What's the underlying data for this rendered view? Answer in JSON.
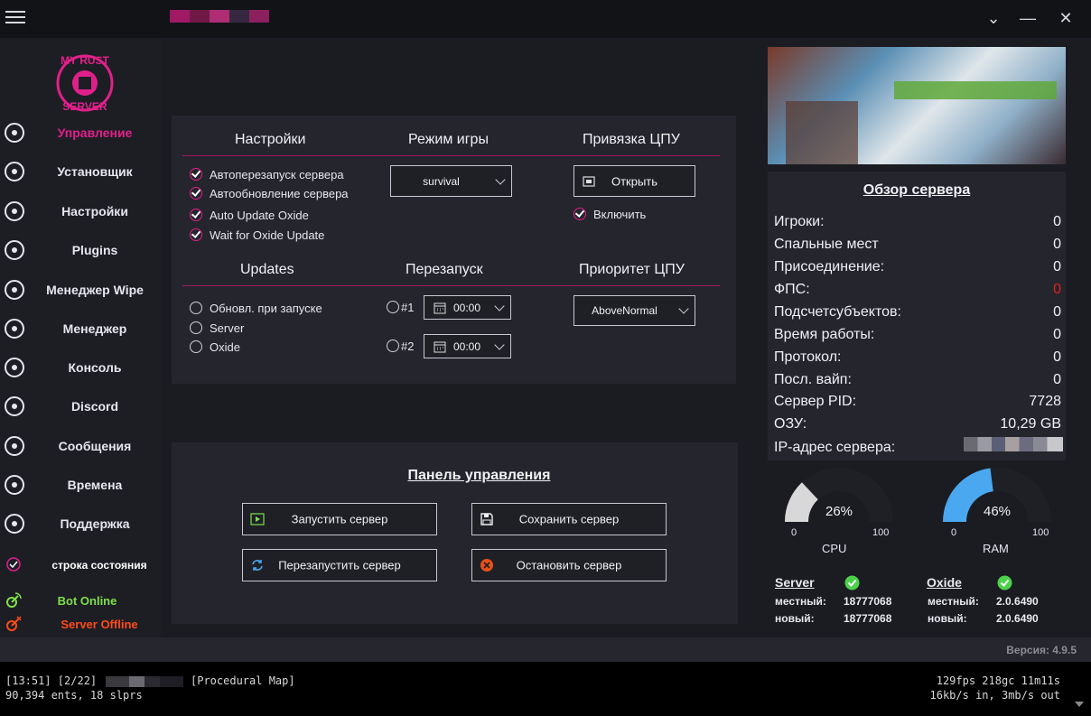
{
  "window": {
    "controls": {
      "collapse": "⌄",
      "minimize": "—",
      "close": "✕"
    }
  },
  "sidebar": {
    "logo_text": "MY RUST SERVER",
    "items": [
      {
        "label": "Управление",
        "icon": "dashboard-icon"
      },
      {
        "label": "Установщик",
        "icon": "gear-icon"
      },
      {
        "label": "Настройки",
        "icon": "sliders-icon"
      },
      {
        "label": "Plugins",
        "icon": "plug-icon"
      },
      {
        "label": "Менеджер Wipe",
        "icon": "layers-icon"
      },
      {
        "label": "Менеджер",
        "icon": "user-icon"
      },
      {
        "label": "Консоль",
        "icon": "terminal-icon"
      },
      {
        "label": "Discord",
        "icon": "discord-icon"
      },
      {
        "label": "Сообщения",
        "icon": "chat-icon"
      },
      {
        "label": "Времена",
        "icon": "clock-icon"
      },
      {
        "label": "Поддержка",
        "icon": "support-icon"
      }
    ],
    "status_bar_label": "строка состояния",
    "bot_status": "Bot Online",
    "server_status": "Server Offline",
    "colors": {
      "accent": "#e0208a",
      "bot_online": "#7ee04a",
      "server_offline": "#ff4a1a"
    }
  },
  "settings": {
    "heading": "Настройки",
    "checks": [
      "Автоперезапуск сервера",
      "Автообновление сервера",
      "Auto Update Oxide",
      "Wait for Oxide Update"
    ],
    "game_mode_heading": "Режим игры",
    "game_mode": "survival",
    "cpu_affinity_heading": "Привязка ЦПУ",
    "open_button": "Открыть",
    "enable_check": "Включить",
    "updates_heading": "Updates",
    "update_options": [
      "Обновл. при запуске",
      "Server",
      "Oxide"
    ],
    "restart_heading": "Перезапуск",
    "restarts": [
      {
        "label": "#1",
        "time": "00:00"
      },
      {
        "label": "#2",
        "time": "00:00"
      }
    ],
    "cpu_priority_heading": "Приоритет ЦПУ",
    "cpu_priority": "AboveNormal"
  },
  "control_panel": {
    "title": "Панель управления",
    "buttons": {
      "start": "Запустить сервер",
      "save": "Сохранить сервер",
      "restart": "Перезапустить сервер",
      "stop": "Остановить сервер"
    }
  },
  "overview": {
    "title": "Обзор сервера",
    "rows": [
      {
        "label": "Игроки:",
        "value": "0"
      },
      {
        "label": "Спальные мест",
        "value": "0"
      },
      {
        "label": "Присоединение:",
        "value": "0"
      },
      {
        "label": "ФПС:",
        "value": "0",
        "color": "#e02020"
      },
      {
        "label": "Подсчетсубъектов:",
        "value": "0"
      },
      {
        "label": "Время работы:",
        "value": "0"
      },
      {
        "label": "Протокол:",
        "value": "0"
      },
      {
        "label": "Посл. вайп:",
        "value": "0"
      },
      {
        "label": "Сервер PID:",
        "value": "7728"
      },
      {
        "label": "ОЗУ:",
        "value": "10,29 GB"
      },
      {
        "label": "IP-адрес сервера:",
        "value": ""
      }
    ]
  },
  "gauges": [
    {
      "name": "CPU",
      "percent": 26,
      "display": "26%",
      "min_label": "0",
      "max_label": "100",
      "color": "#d8d8d8"
    },
    {
      "name": "RAM",
      "percent": 46,
      "display": "46%",
      "min_label": "0",
      "max_label": "100",
      "color": "#4aa8f0"
    }
  ],
  "versions": {
    "server": {
      "title": "Server",
      "local_label": "местный:",
      "local": "18777068",
      "new_label": "новый:",
      "new": "18777068"
    },
    "oxide": {
      "title": "Oxide",
      "local_label": "местный:",
      "local": "2.0.6490",
      "new_label": "новый:",
      "new": "2.0.6490"
    }
  },
  "version_label": "Версия: 4.9.5",
  "console": {
    "line1_left": "[13:51] [2/22]",
    "line1_map": "[Procedural Map]",
    "line2_left": "90,394 ents, 18 slprs",
    "line1_right": "129fps 218gc 11m11s",
    "line2_right": "16kb/s in, 3mb/s out"
  }
}
